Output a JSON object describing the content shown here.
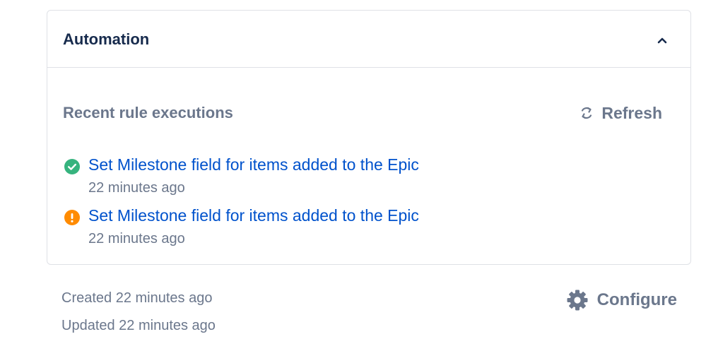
{
  "panel": {
    "title": "Automation",
    "collapse_icon": "chevron-up-icon"
  },
  "executions": {
    "title": "Recent rule executions",
    "refresh_label": "Refresh",
    "items": [
      {
        "status": "success",
        "status_color": "#36b37e",
        "rule_name": "Set Milestone field for items added to the Epic",
        "time": "22 minutes ago"
      },
      {
        "status": "warning",
        "status_color": "#ff8b00",
        "rule_name": "Set Milestone field for items added to the Epic",
        "time": "22 minutes ago"
      }
    ]
  },
  "footer": {
    "created": "Created 22 minutes ago",
    "updated": "Updated 22 minutes ago",
    "configure_label": "Configure"
  },
  "colors": {
    "link": "#0052cc",
    "muted": "#6b778c",
    "heading": "#172b4d",
    "border": "#dfe1e6"
  }
}
